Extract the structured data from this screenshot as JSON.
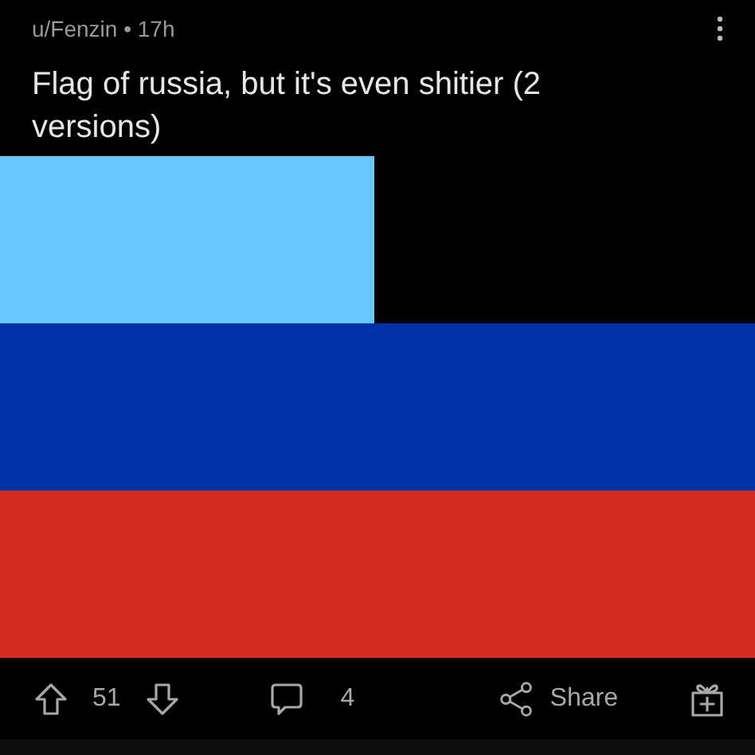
{
  "post": {
    "author": "u/Fenzin",
    "separator": "•",
    "age": "17h",
    "title": "Flag of russia, but it's even shitier (2 versions)"
  },
  "actions": {
    "upvotes": "51",
    "comments": "4",
    "share": "Share"
  }
}
